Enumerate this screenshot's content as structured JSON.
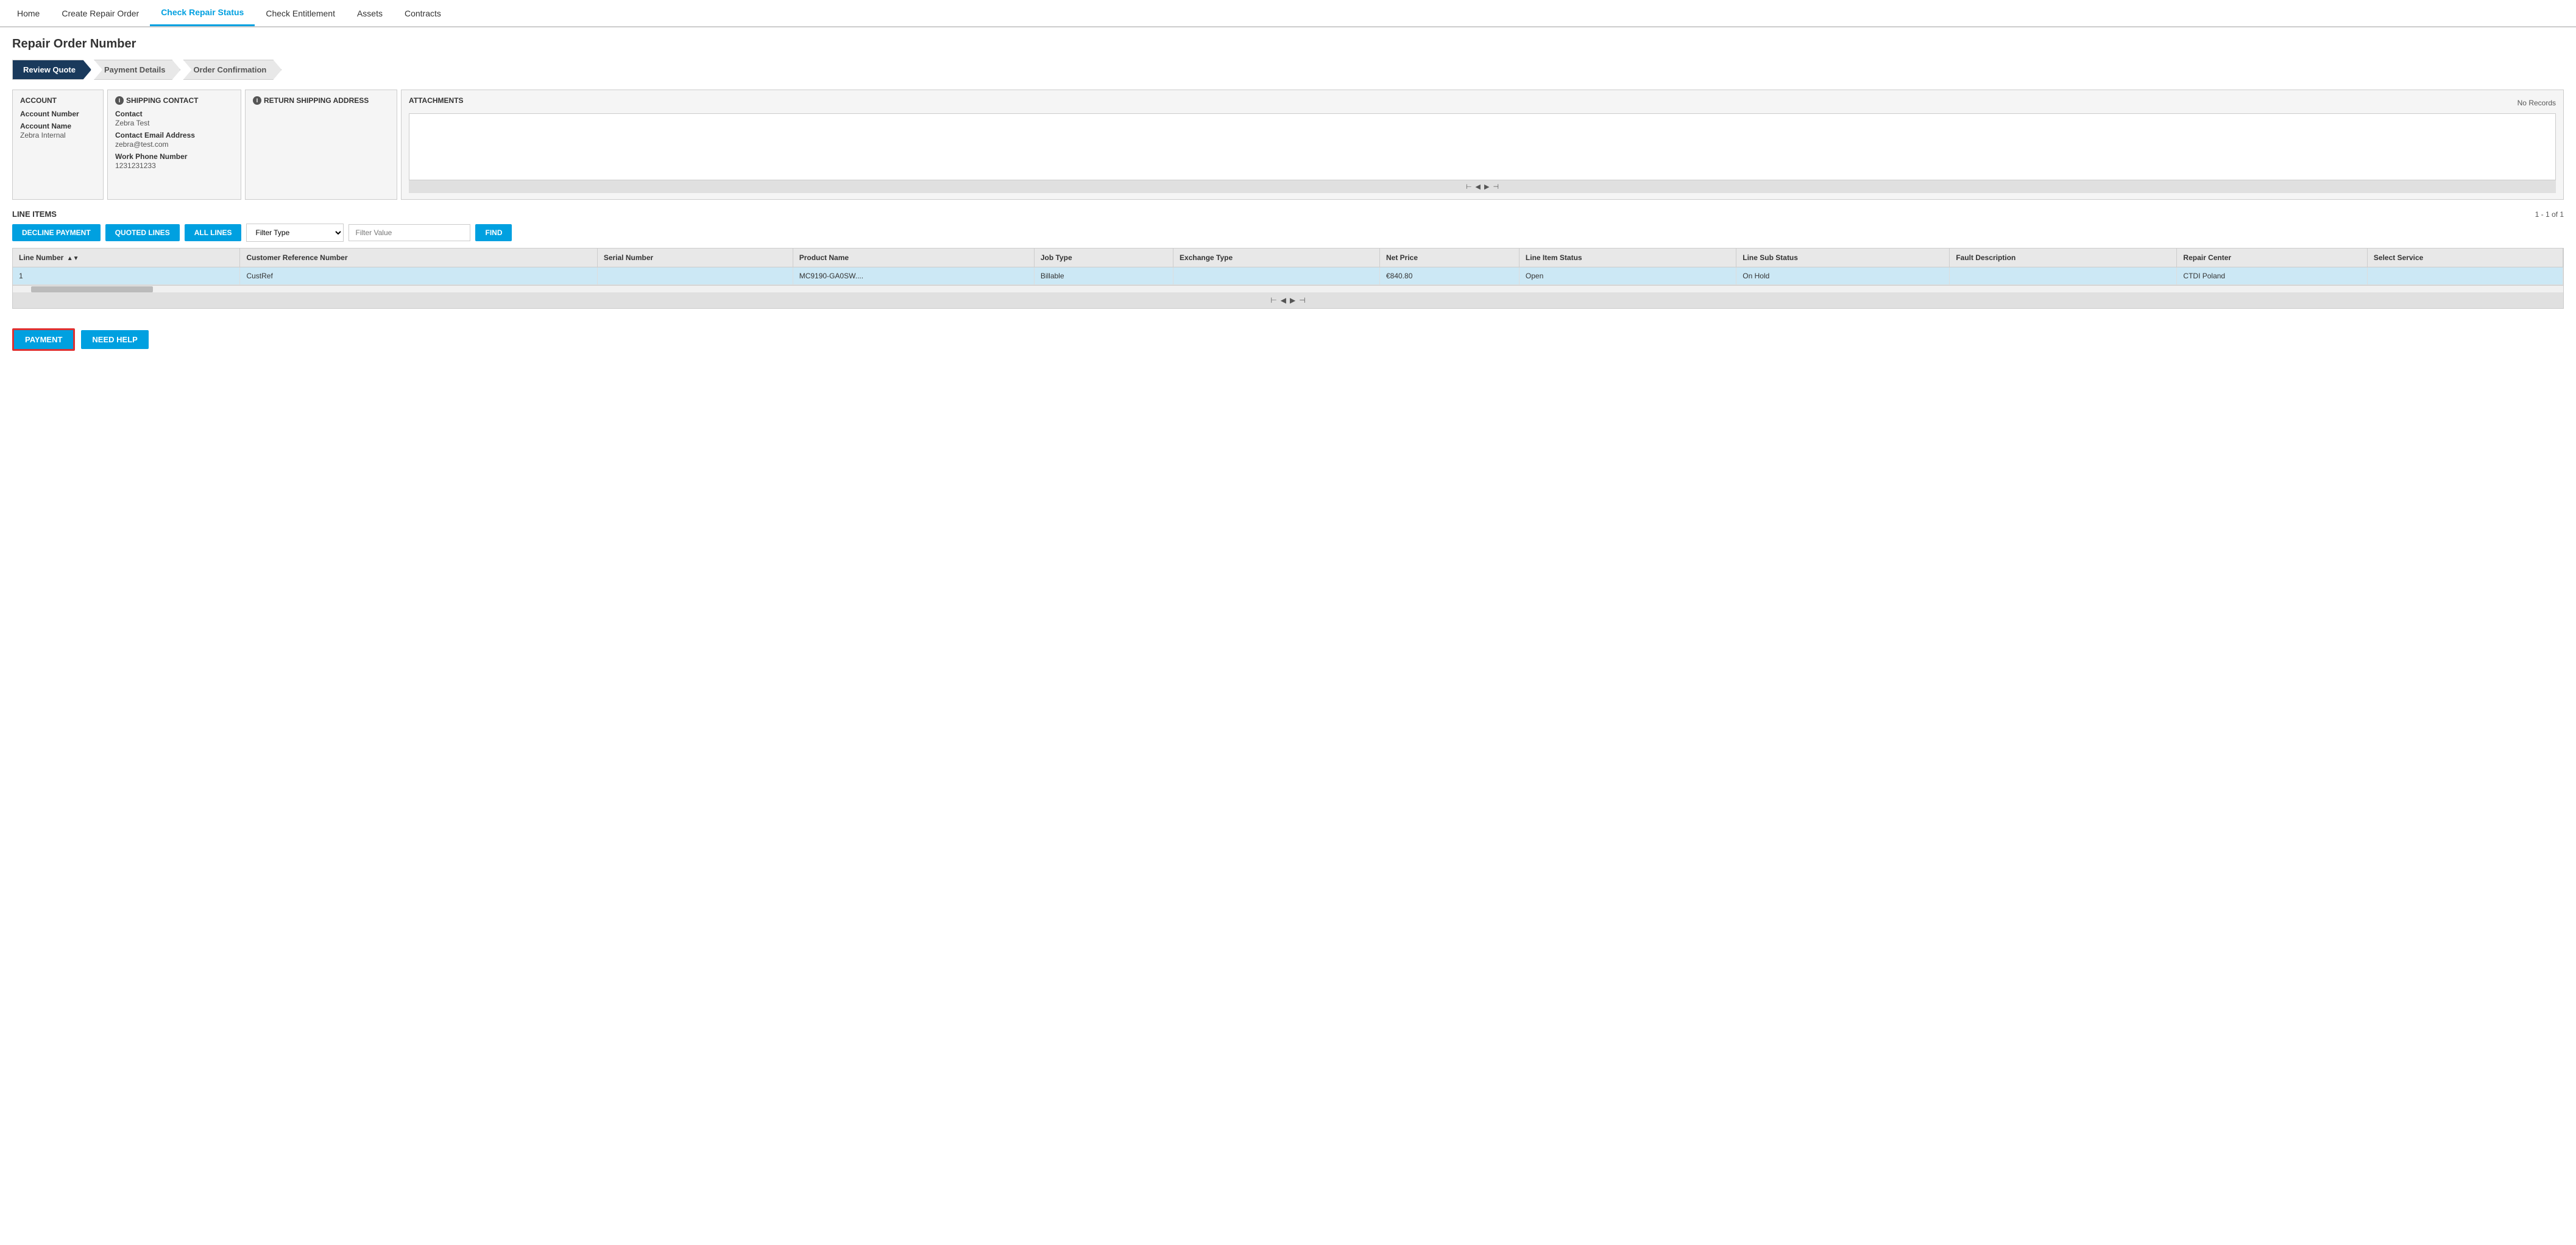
{
  "nav": {
    "items": [
      {
        "label": "Home",
        "active": false
      },
      {
        "label": "Create Repair Order",
        "active": false
      },
      {
        "label": "Check Repair Status",
        "active": true
      },
      {
        "label": "Check Entitlement",
        "active": false
      },
      {
        "label": "Assets",
        "active": false
      },
      {
        "label": "Contracts",
        "active": false
      }
    ]
  },
  "page": {
    "title": "Repair Order Number"
  },
  "wizard": {
    "steps": [
      {
        "label": "Review Quote",
        "active": true
      },
      {
        "label": "Payment Details",
        "active": false
      },
      {
        "label": "Order Confirmation",
        "active": false
      }
    ]
  },
  "account_panel": {
    "header": "ACCOUNT",
    "fields": [
      {
        "label": "Account Number",
        "value": ""
      },
      {
        "label": "Account Name",
        "value": "Zebra Internal"
      }
    ]
  },
  "shipping_panel": {
    "header": "SHIPPING CONTACT",
    "fields": [
      {
        "label": "Contact",
        "value": "Zebra Test"
      },
      {
        "label": "Contact Email Address",
        "value": "zebra@test.com"
      },
      {
        "label": "Work Phone Number",
        "value": "1231231233"
      }
    ]
  },
  "return_panel": {
    "header": "RETURN SHIPPING ADDRESS",
    "fields": []
  },
  "attachments_panel": {
    "header": "ATTACHMENTS",
    "no_records": "No Records"
  },
  "line_items": {
    "title": "LINE ITEMS",
    "pagination": "1 - 1 of 1",
    "buttons": {
      "decline": "DECLINE PAYMENT",
      "quoted": "QUOTED LINES",
      "all": "ALL LINES",
      "find": "FIND"
    },
    "filter_type_placeholder": "Filter Type",
    "filter_value_placeholder": "Filter Value",
    "columns": [
      "Line Number",
      "Customer Reference Number",
      "Serial Number",
      "Product Name",
      "Job Type",
      "Exchange Type",
      "Net Price",
      "Line Item Status",
      "Line Sub Status",
      "Fault Description",
      "Repair Center",
      "Select Service"
    ],
    "rows": [
      {
        "line_number": "1",
        "customer_ref": "CustRef",
        "serial_number": "",
        "product_name": "MC9190-GA0SW....",
        "job_type": "Billable",
        "exchange_type": "",
        "net_price": "€840.80",
        "line_item_status": "Open",
        "line_sub_status": "On Hold",
        "fault_description": "",
        "repair_center": "CTDI Poland",
        "select_service": ""
      }
    ]
  },
  "bottom_buttons": {
    "payment": "PAYMENT",
    "need_help": "NEED HELP"
  },
  "icons": {
    "first": "⊢",
    "prev": "◀",
    "next": "▶",
    "last": "⊣",
    "sort_asc": "▲",
    "sort_desc": "▼",
    "info": "i"
  }
}
